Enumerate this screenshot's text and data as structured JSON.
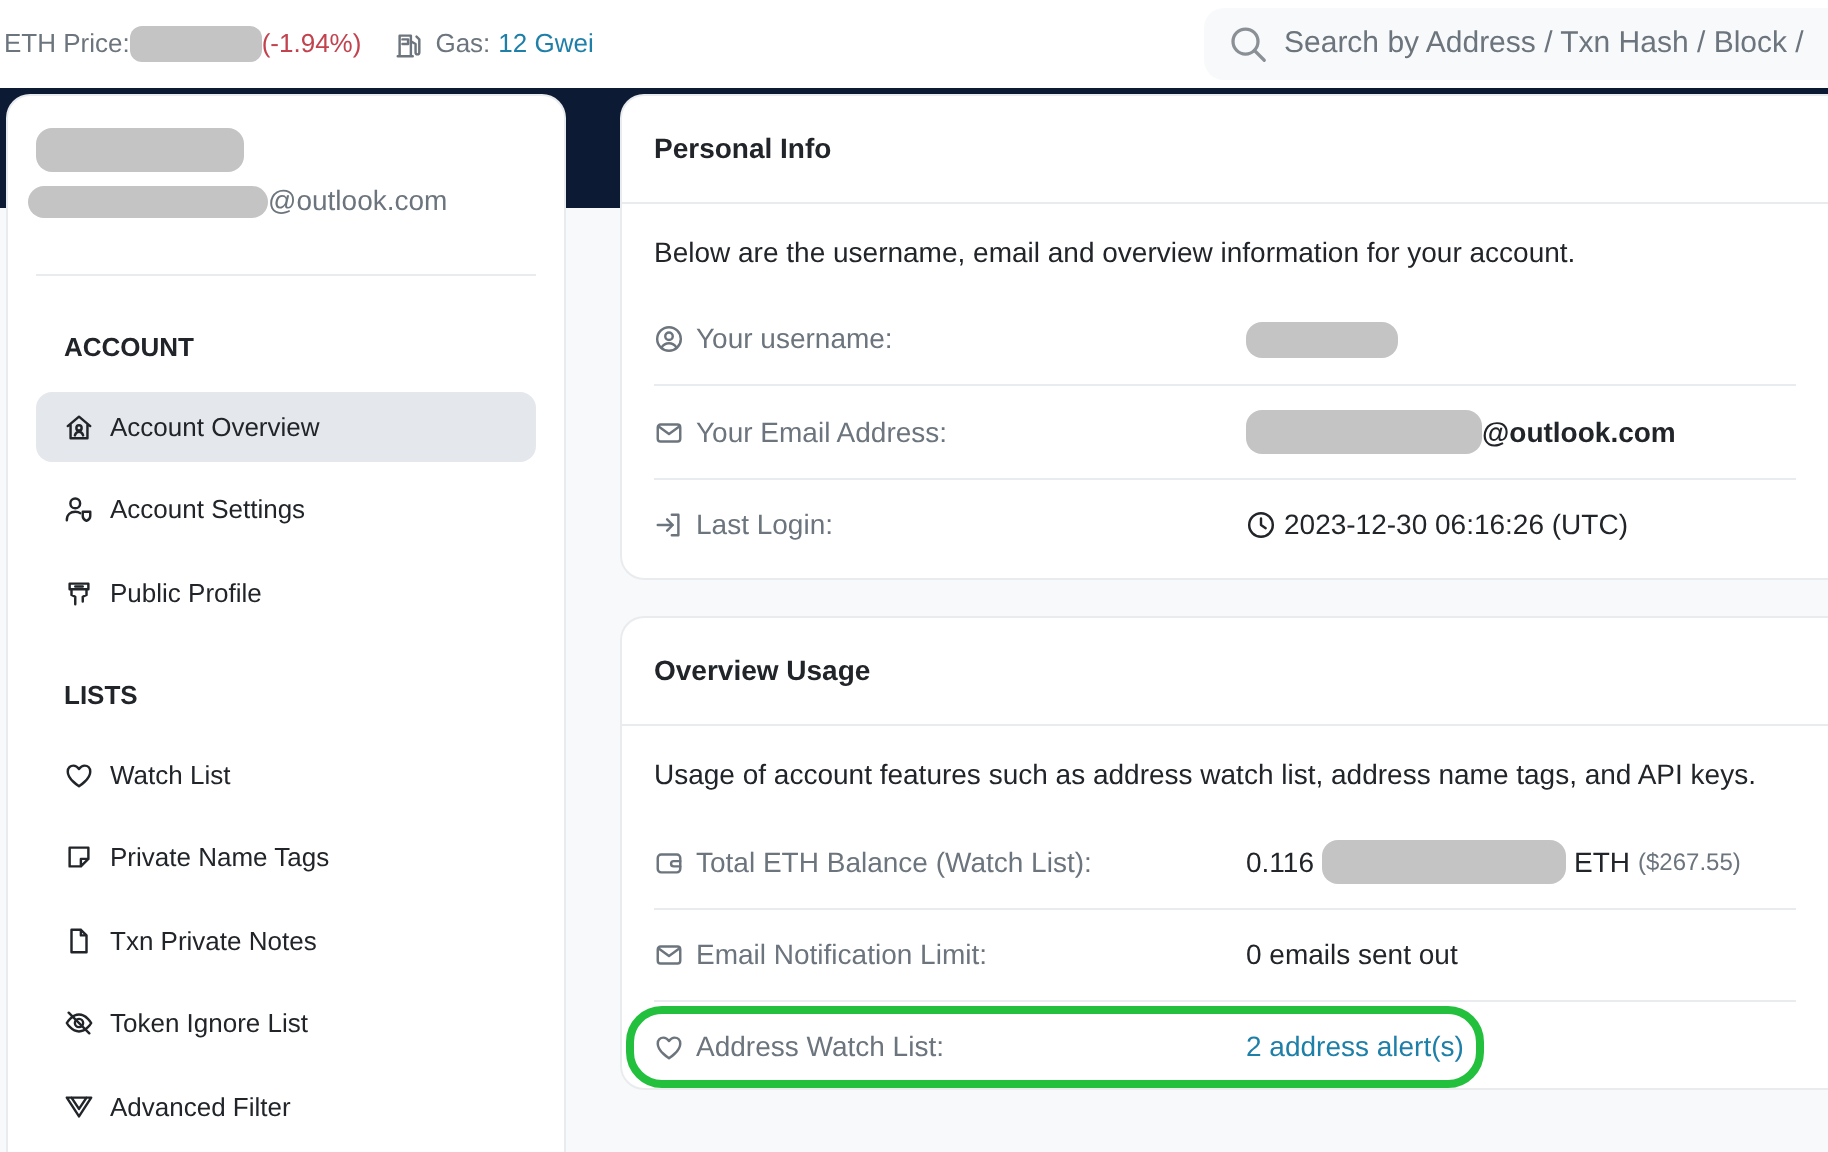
{
  "topbar": {
    "eth_price": {
      "label": "ETH Price:",
      "change": "(-1.94%)"
    },
    "gas": {
      "label": "Gas:",
      "value": "12 Gwei"
    },
    "search": {
      "placeholder": "Search by Address / Txn Hash / Block /"
    }
  },
  "profile": {
    "email_domain": "@outlook.com"
  },
  "sidebar": [
    {
      "heading": "ACCOUNT",
      "items": [
        {
          "kind": "home",
          "label": "Account Overview",
          "selected": true
        },
        {
          "kind": "usergear",
          "label": "Account Settings",
          "selected": false
        },
        {
          "kind": "profile",
          "label": "Public Profile",
          "selected": false
        }
      ]
    },
    {
      "heading": "LISTS",
      "items": [
        {
          "kind": "heart",
          "label": "Watch List",
          "selected": false
        },
        {
          "kind": "note",
          "label": "Private Name Tags",
          "selected": false
        },
        {
          "kind": "file",
          "label": "Txn Private Notes",
          "selected": false
        },
        {
          "kind": "eyeslash",
          "label": "Token Ignore List",
          "selected": false
        },
        {
          "kind": "filter",
          "label": "Advanced Filter",
          "selected": false
        }
      ]
    }
  ],
  "cards": [
    {
      "title": "Personal Info",
      "intro": "Below are the username, email and overview information for your account.",
      "rows": [
        {
          "kind": "user",
          "label": "Your username:",
          "highlighted": false,
          "value": [
            {
              "kind": "redacted"
            }
          ]
        },
        {
          "kind": "mail",
          "label": "Your Email Address:",
          "highlighted": false,
          "value": [
            {
              "kind": "redacted"
            },
            {
              "kind": "bold",
              "text": "@outlook.com"
            }
          ]
        },
        {
          "kind": "login",
          "label": "Last Login:",
          "highlighted": false,
          "value": [
            {
              "kind": "clock"
            },
            {
              "kind": "plain",
              "text": "2023-12-30 06:16:26 (UTC)"
            }
          ]
        }
      ]
    },
    {
      "title": "Overview Usage",
      "intro": "Usage of account features such as address watch list, address name tags, and API keys.",
      "rows": [
        {
          "kind": "wallet",
          "label": "Total ETH Balance (Watch List):",
          "highlighted": false,
          "value": [
            {
              "kind": "plain",
              "text": "0.116"
            },
            {
              "kind": "redacted"
            },
            {
              "kind": "plain",
              "text": "ETH"
            },
            {
              "kind": "muted",
              "text": "($267.55)"
            }
          ]
        },
        {
          "kind": "mail",
          "label": "Email Notification Limit:",
          "highlighted": false,
          "value": [
            {
              "kind": "plain",
              "text": "0 emails sent out"
            }
          ]
        },
        {
          "kind": "heart",
          "label": "Address Watch List:",
          "highlighted": true,
          "value": [
            {
              "kind": "link",
              "text": "2 address alert(s)"
            }
          ]
        }
      ]
    }
  ]
}
